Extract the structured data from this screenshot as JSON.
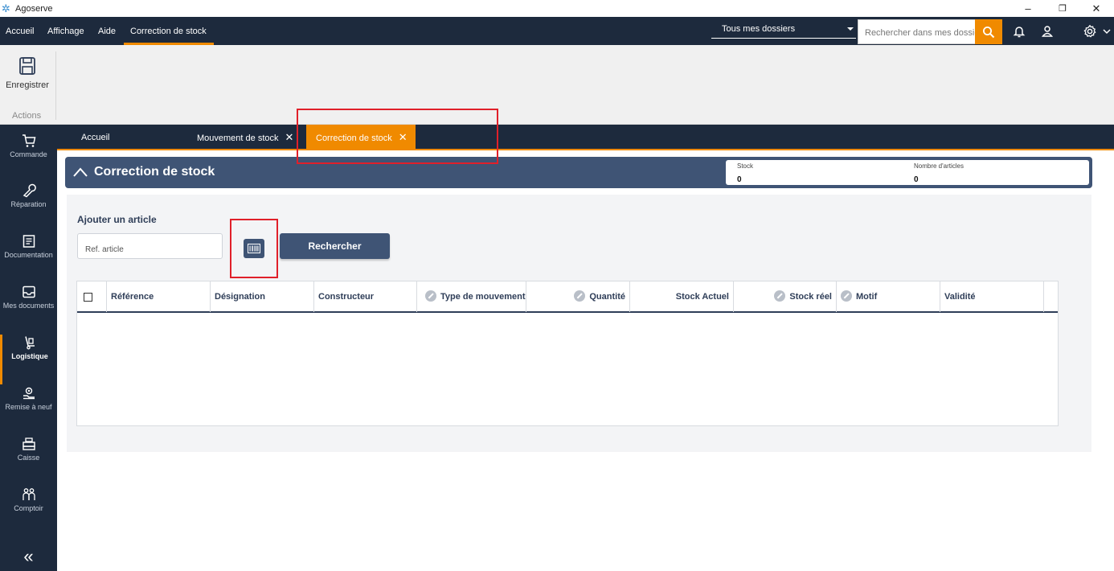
{
  "window": {
    "title": "Agoserve",
    "controls": {
      "minimize": "–",
      "restore": "❐",
      "close": "✕"
    }
  },
  "topnav": {
    "menu": [
      "Accueil",
      "Affichage",
      "Aide",
      "Correction de stock"
    ],
    "active_menu": "Correction de stock",
    "dossier_select": "Tous mes dossiers",
    "search_placeholder": "Rechercher dans mes dossiers",
    "icons": [
      "search-icon",
      "bell-icon",
      "user-icon",
      "gear-icon",
      "chevron-down-icon"
    ]
  },
  "ribbon": {
    "save_label": "Enregistrer",
    "group_label": "Actions"
  },
  "sidebar": {
    "items": [
      {
        "label": "Commande",
        "icon": "cart-icon"
      },
      {
        "label": "Réparation",
        "icon": "wrench-icon"
      },
      {
        "label": "Documentation",
        "icon": "document-icon"
      },
      {
        "label": "Mes documents",
        "icon": "inbox-icon"
      },
      {
        "label": "Logistique",
        "icon": "hand-truck-icon",
        "active": true
      },
      {
        "label": "Remise à neuf",
        "icon": "refurbish-icon"
      },
      {
        "label": "Caisse",
        "icon": "cash-register-icon"
      },
      {
        "label": "Comptoir",
        "icon": "counter-people-icon"
      }
    ],
    "collapse_glyph": "«"
  },
  "tabs": [
    {
      "label": "Accueil",
      "closable": false
    },
    {
      "label": "Mouvement de stock",
      "closable": true
    },
    {
      "label": "Correction de stock",
      "closable": true,
      "active": true
    }
  ],
  "page": {
    "title": "Correction de stock",
    "stats": [
      {
        "label": "Stock",
        "value": "0"
      },
      {
        "label": "Nombre d'articles",
        "value": "0"
      }
    ],
    "add_article_title": "Ajouter un article",
    "ref_placeholder": "Ref. article",
    "search_button": "Rechercher",
    "table": {
      "columns": [
        {
          "label": "Référence",
          "locked": false
        },
        {
          "label": "Désignation",
          "locked": false
        },
        {
          "label": "Constructeur",
          "locked": false
        },
        {
          "label": "Type de mouvement",
          "locked": true
        },
        {
          "label": "Quantité",
          "locked": true
        },
        {
          "label": "Stock Actuel",
          "locked": false
        },
        {
          "label": "Stock réel",
          "locked": true
        },
        {
          "label": "Motif",
          "locked": true
        },
        {
          "label": "Validité",
          "locked": false
        }
      ],
      "rows": []
    }
  },
  "colors": {
    "nav_bg": "#1d2a3d",
    "accent": "#f08a00",
    "header_bg": "#3f5475",
    "annotation": "#e0202a"
  }
}
